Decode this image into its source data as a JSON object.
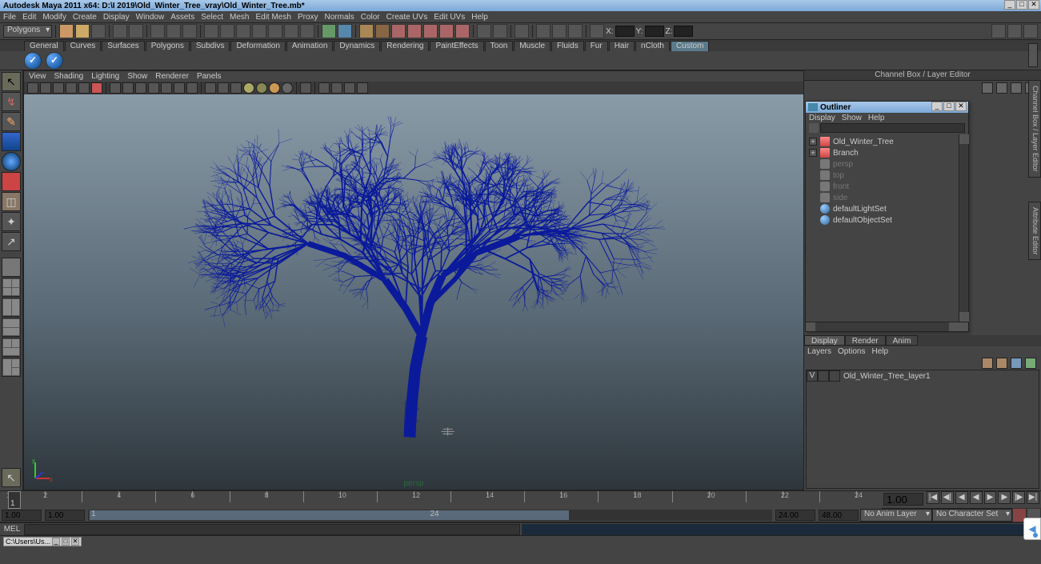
{
  "title": "Autodesk Maya 2011 x64: D:\\I 2019\\Old_Winter_Tree_vray\\Old_Winter_Tree.mb*",
  "menu": {
    "items": [
      "File",
      "Edit",
      "Modify",
      "Create",
      "Display",
      "Window",
      "Assets",
      "Select",
      "Mesh",
      "Edit Mesh",
      "Proxy",
      "Normals",
      "Color",
      "Create UVs",
      "Edit UVs",
      "Help"
    ]
  },
  "status_line": {
    "mode_dropdown": "Polygons",
    "coord_fields": {
      "x_label": "X:",
      "y_label": "Y:",
      "z_label": "Z:",
      "x": "",
      "y": "",
      "z": ""
    }
  },
  "shelf": {
    "tabs": [
      "General",
      "Curves",
      "Surfaces",
      "Polygons",
      "Subdivs",
      "Deformation",
      "Animation",
      "Dynamics",
      "Rendering",
      "PaintEffects",
      "Toon",
      "Muscle",
      "Fluids",
      "Fur",
      "Hair",
      "nCloth",
      "Custom"
    ],
    "active_tab": "Custom"
  },
  "viewport": {
    "menu": [
      "View",
      "Shading",
      "Lighting",
      "Show",
      "Renderer",
      "Panels"
    ],
    "camera_label": "persp"
  },
  "right_panel": {
    "title": "Channel Box / Layer Editor",
    "side_tabs": [
      "Channel Box / Layer Editor",
      "Attribute Editor"
    ]
  },
  "outliner": {
    "title": "Outliner",
    "menu": [
      "Display",
      "Show",
      "Help"
    ],
    "search": "",
    "items": [
      {
        "label": "Old_Winter_Tree",
        "type": "mesh",
        "exp": true
      },
      {
        "label": "Branch",
        "type": "mesh",
        "exp": true
      },
      {
        "label": "persp",
        "type": "cam",
        "dim": true
      },
      {
        "label": "top",
        "type": "cam",
        "dim": true
      },
      {
        "label": "front",
        "type": "cam",
        "dim": true
      },
      {
        "label": "side",
        "type": "cam",
        "dim": true
      },
      {
        "label": "defaultLightSet",
        "type": "set"
      },
      {
        "label": "defaultObjectSet",
        "type": "set"
      }
    ]
  },
  "layer_editor": {
    "tabs": [
      "Display",
      "Render",
      "Anim"
    ],
    "active_tab": "Display",
    "menu": [
      "Layers",
      "Options",
      "Help"
    ],
    "layers": [
      {
        "vis": "V",
        "type": "",
        "name": "Old_Winter_Tree_layer1"
      }
    ]
  },
  "timeline": {
    "start_label": "1",
    "current": "1.00",
    "frame_field": "1.00",
    "range_start_outer": "1.00",
    "range_start": "1.00",
    "range_bar_start": "1",
    "range_bar_end": "24",
    "range_end": "24.00",
    "range_end_outer": "48.00",
    "anim_layer": "No Anim Layer",
    "char_set": "No Character Set"
  },
  "cmd": {
    "label": "MEL"
  },
  "help_line_win": "C:\\Users\\Us..."
}
